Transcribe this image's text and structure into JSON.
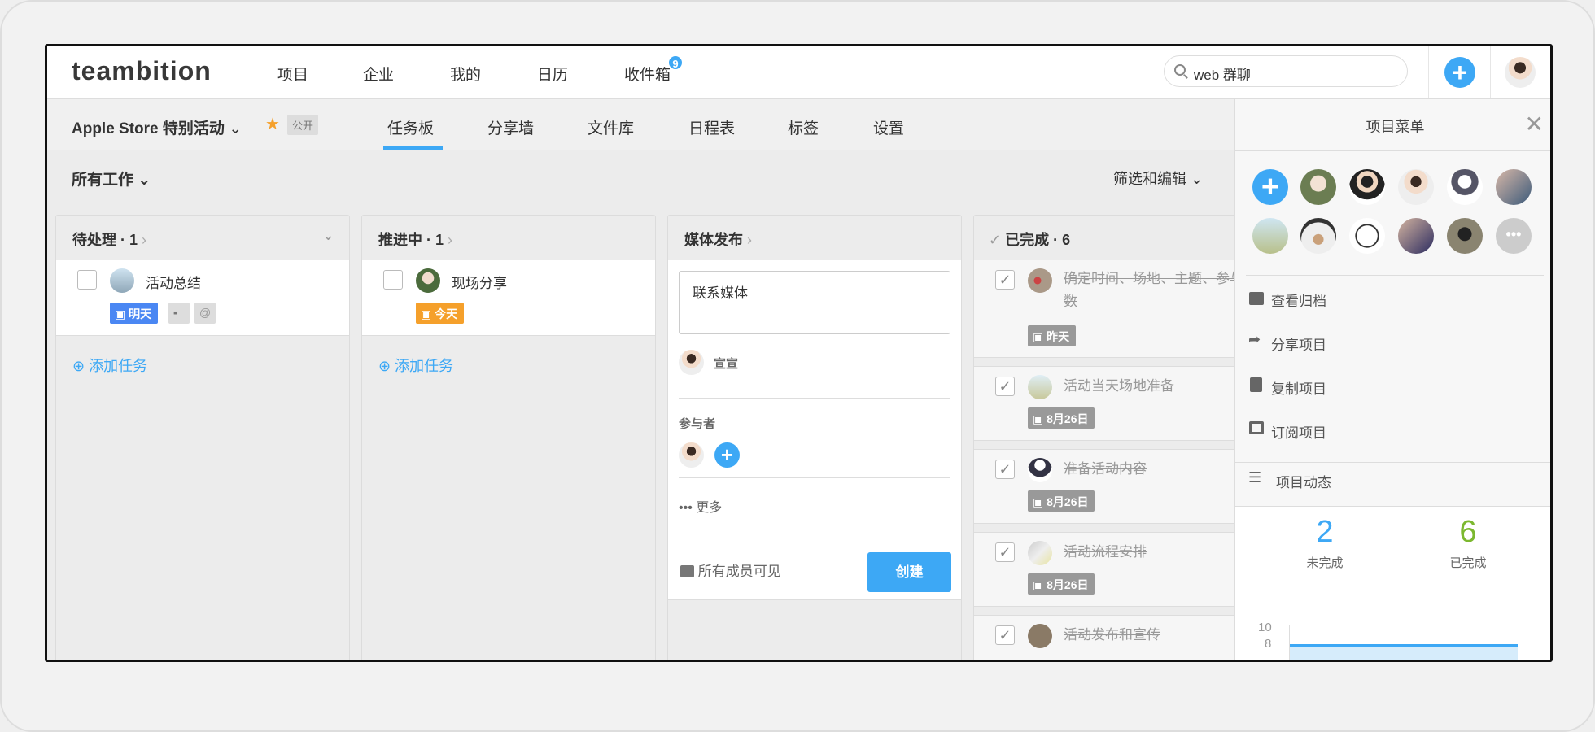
{
  "topnav": {
    "logo": "teambition",
    "items": [
      "项目",
      "企业",
      "我的",
      "日历",
      "收件箱"
    ],
    "inbox_badge": "9",
    "search_value": "web 群聊"
  },
  "project": {
    "title": "Apple Store 特别活动",
    "visibility": "公开",
    "tabs": [
      "任务板",
      "分享墙",
      "文件库",
      "日程表",
      "标签",
      "设置"
    ],
    "active_tab": "任务板"
  },
  "filter": {
    "scope": "所有工作",
    "edit": "筛选和编辑"
  },
  "columns": [
    {
      "title": "待处理 · 1",
      "tasks": [
        {
          "title": "活动总结",
          "due": "明天",
          "due_color": "#4a87f3"
        }
      ],
      "add": "添加任务"
    },
    {
      "title": "推进中 · 1",
      "tasks": [
        {
          "title": "现场分享",
          "due": "今天",
          "due_color": "#f5a02b"
        }
      ],
      "add": "添加任务"
    },
    {
      "title": "媒体发布",
      "new_task": {
        "content": "联系媒体",
        "assignee": "宣宣",
        "participants_label": "参与者",
        "more": "更多",
        "visibility": "所有成员可见",
        "create": "创建"
      }
    },
    {
      "title": "已完成 · 6",
      "tasks": [
        {
          "title": "确定时间、场地、主题、参与人数",
          "due": "昨天"
        },
        {
          "title": "活动当天场地准备",
          "due": "8月26日"
        },
        {
          "title": "准备活动内容",
          "due": "8月26日"
        },
        {
          "title": "活动流程安排",
          "due": "8月26日"
        },
        {
          "title": "活动发布和宣传"
        }
      ]
    }
  ],
  "panel": {
    "title": "项目菜单",
    "menu": [
      "查看归档",
      "分享项目",
      "复制项目",
      "订阅项目"
    ],
    "activity": "项目动态",
    "stats": {
      "incomplete": "2",
      "incomplete_label": "未完成",
      "complete": "6",
      "complete_label": "已完成"
    },
    "chart_ticks": [
      "10",
      "8"
    ],
    "colors": {
      "accent": "#3da8f5",
      "done": "#7cb82f"
    }
  }
}
